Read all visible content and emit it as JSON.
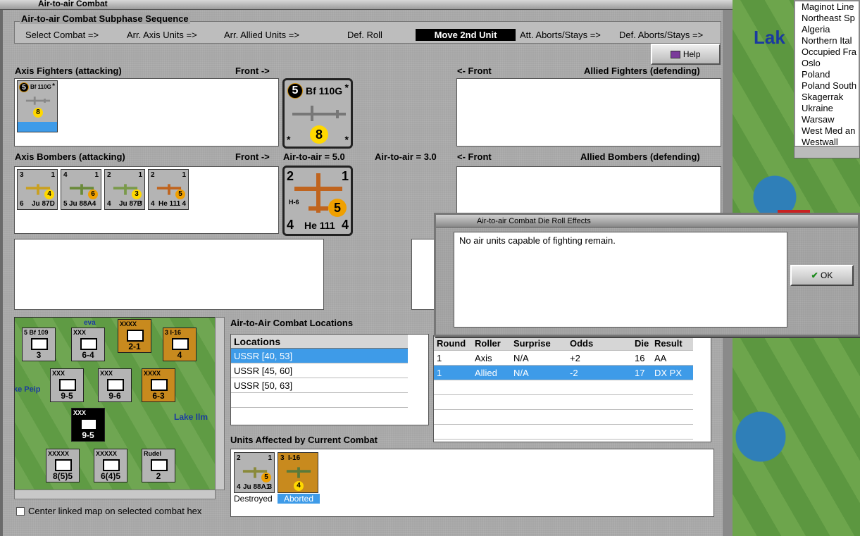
{
  "window": {
    "title": "Air-to-air Combat"
  },
  "map": {
    "lake_label": "Lak"
  },
  "region_list": [
    "Maginot Line",
    "Northeast Sp",
    "Algeria",
    "Northern Ital",
    "Occupied Fra",
    "Oslo",
    "Poland",
    "Poland South",
    "Skagerrak",
    "Ukraine",
    "Warsaw",
    "West Med an",
    "Westwall"
  ],
  "sequence": {
    "title": "Air-to-air Combat Subphase Sequence",
    "steps": [
      "Select Combat =>",
      "Arr. Axis Units =>",
      "Arr. Allied Units =>",
      "Def. Roll",
      "Move 2nd Unit",
      "Att. Aborts/Stays =>",
      "Def. Aborts/Stays =>"
    ],
    "active": "Move 2nd Unit"
  },
  "help": {
    "label": "Help"
  },
  "sections": {
    "axis_fighters": "Axis Fighters (attacking)",
    "front_right_1": "Front ->",
    "front_left_1": "<- Front",
    "allied_fighters": "Allied Fighters (defending)",
    "axis_bombers": "Axis Bombers (attacking)",
    "front_right_2": "Front ->",
    "air_to_air_axis": "Air-to-air = 5.0",
    "air_to_air_allied": "Air-to-air = 3.0",
    "front_left_2": "<- Front",
    "allied_bombers": "Allied Bombers (defending)"
  },
  "axis_fighter_unit": {
    "name": "Bf 110G",
    "air": "5",
    "strength": "8",
    "corner": "*"
  },
  "axis_bombers": [
    {
      "name": "Ju 87D",
      "tl": "3",
      "tr": "1",
      "bl": "6",
      "br": "4",
      "str": "4"
    },
    {
      "name": "Ju 88A4",
      "tl": "4",
      "tr": "1",
      "bl": "5",
      "br": "4",
      "str": "6"
    },
    {
      "name": "Ju 87B",
      "tl": "2",
      "tr": "1",
      "bl": "4",
      "br": "*",
      "str": "3"
    },
    {
      "name": "He 111",
      "tl": "2",
      "tr": "1",
      "bl": "4",
      "br": "4",
      "str": "5",
      "sub": "H-6"
    }
  ],
  "big_bomber": {
    "name": "He 111",
    "sub": "H-6",
    "tl": "2",
    "tr": "1",
    "bl": "4",
    "br": "4",
    "str": "5"
  },
  "mini_map": {
    "lake1": "Lake Ilm",
    "lake2": "ke Peip",
    "units": [
      {
        "top": "5 Bf 109",
        "val": "3"
      },
      {
        "top": "XXX",
        "val": "6-4"
      },
      {
        "top": "XXXX",
        "val": "2-1"
      },
      {
        "top": "3 I-16",
        "val": "4"
      },
      {
        "top": "XXX",
        "val": "9-5"
      },
      {
        "top": "XXX",
        "val": "9-6"
      },
      {
        "top": "XXXX",
        "val": "6-3"
      },
      {
        "top": "XXX",
        "val": "9-5"
      },
      {
        "top": "XXXXX",
        "val": "8(5)5"
      },
      {
        "top": "XXXXX",
        "val": "6(4)5"
      },
      {
        "top": "Rudel",
        "val": "2"
      }
    ]
  },
  "center_checkbox": "Center linked map on selected combat hex",
  "locations": {
    "title": "Air-to-Air Combat Locations",
    "header": "Locations",
    "rows": [
      "USSR [40, 53]",
      "USSR [45, 60]",
      "USSR [50, 63]"
    ]
  },
  "results": {
    "headers": [
      "Round",
      "Roller",
      "Surprise",
      "Odds",
      "Die",
      "Result"
    ],
    "rows": [
      [
        "1",
        "Axis",
        "N/A",
        "+2",
        "16",
        "AA"
      ],
      [
        "1",
        "Allied",
        "N/A",
        "-2",
        "17",
        "DX PX"
      ]
    ]
  },
  "affected": {
    "title": "Units Affected by Current Combat",
    "units": [
      {
        "name": "Ju 88A1",
        "tl": "2",
        "tr": "1",
        "bl": "4",
        "br": "3",
        "str": "5",
        "status": "Destroyed"
      },
      {
        "name": "I-16",
        "tl": "3",
        "str": "4",
        "status": "Aborted"
      }
    ]
  },
  "dialog": {
    "title": "Air-to-air Combat Die Roll Effects",
    "message": "No air units capable of fighting remain.",
    "ok": "OK"
  }
}
